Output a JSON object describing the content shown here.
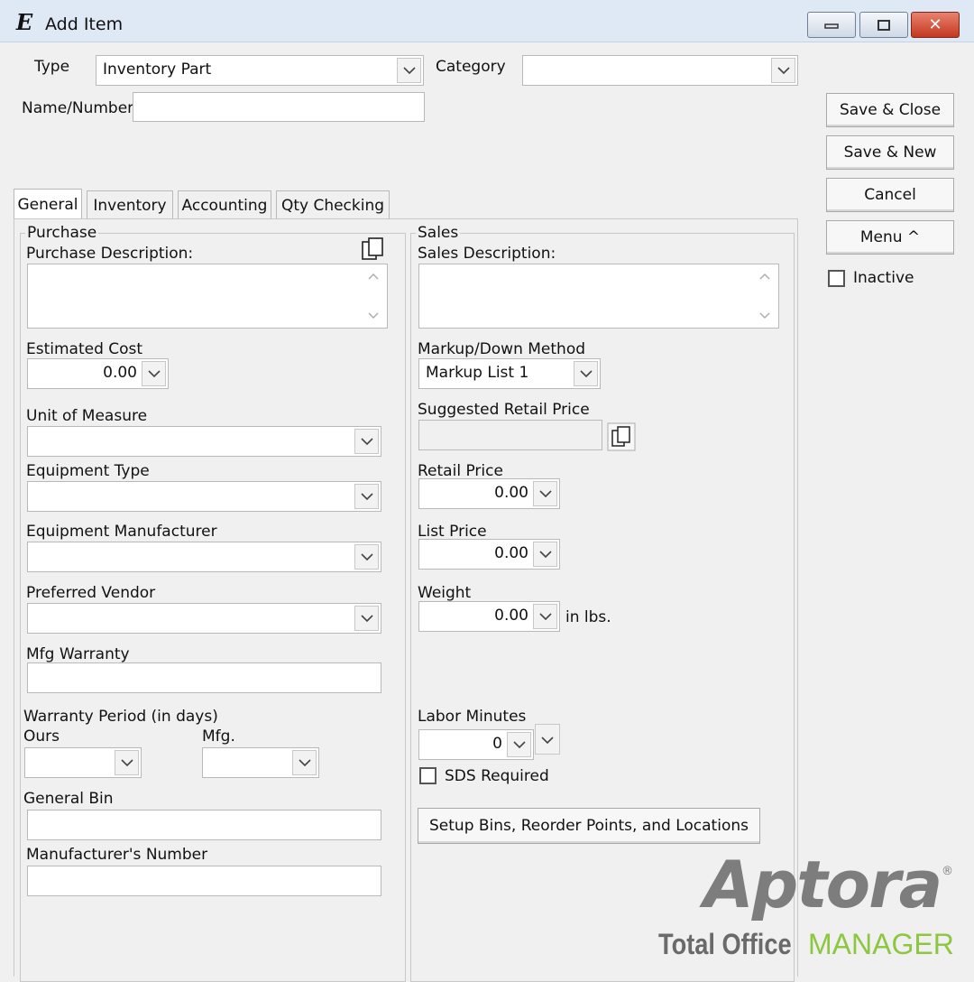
{
  "window": {
    "title": "Add Item",
    "app_icon_glyph": "E"
  },
  "header": {
    "type_label": "Type",
    "type_value": "Inventory Part",
    "category_label": "Category",
    "category_value": "",
    "name_label": "Name/Number",
    "name_value": ""
  },
  "actions": {
    "save_close": "Save & Close",
    "save_new": "Save & New",
    "cancel": "Cancel",
    "menu": "Menu ^",
    "inactive": "Inactive"
  },
  "tabs": [
    "General",
    "Inventory",
    "Accounting",
    "Qty Checking"
  ],
  "purchase": {
    "legend": "Purchase",
    "description_label": "Purchase Description:",
    "estimated_cost_label": "Estimated Cost",
    "estimated_cost_value": "0.00",
    "unit_of_measure_label": "Unit of Measure",
    "equipment_type_label": "Equipment Type",
    "equipment_manufacturer_label": "Equipment Manufacturer",
    "preferred_vendor_label": "Preferred Vendor",
    "mfg_warranty_label": "Mfg Warranty",
    "warranty_period_label": "Warranty Period (in days)",
    "ours_label": "Ours",
    "mfg_label": "Mfg.",
    "general_bin_label": "General Bin",
    "manufacturer_number_label": "Manufacturer's Number"
  },
  "sales": {
    "legend": "Sales",
    "description_label": "Sales Description:",
    "markup_method_label": "Markup/Down Method",
    "markup_method_value": "Markup List 1",
    "suggested_retail_label": "Suggested Retail Price",
    "retail_price_label": "Retail Price",
    "retail_price_value": "0.00",
    "list_price_label": "List Price",
    "list_price_value": "0.00",
    "weight_label": "Weight",
    "weight_value": "0.00",
    "weight_unit": "in lbs.",
    "labor_minutes_label": "Labor Minutes",
    "labor_minutes_value": "0",
    "sds_required_label": "SDS Required",
    "setup_bins_button": "Setup Bins, Reorder Points, and Locations"
  },
  "branding": {
    "logo_text": "Aptora",
    "registered": "®",
    "tagline_1": "Total Office",
    "tagline_2": "MANAGER"
  },
  "colors": {
    "titlebar": "#dfe9f5",
    "close_button": "#c5371f",
    "brand_gray": "#7d7d7d",
    "brand_green": "#8dc63f"
  }
}
